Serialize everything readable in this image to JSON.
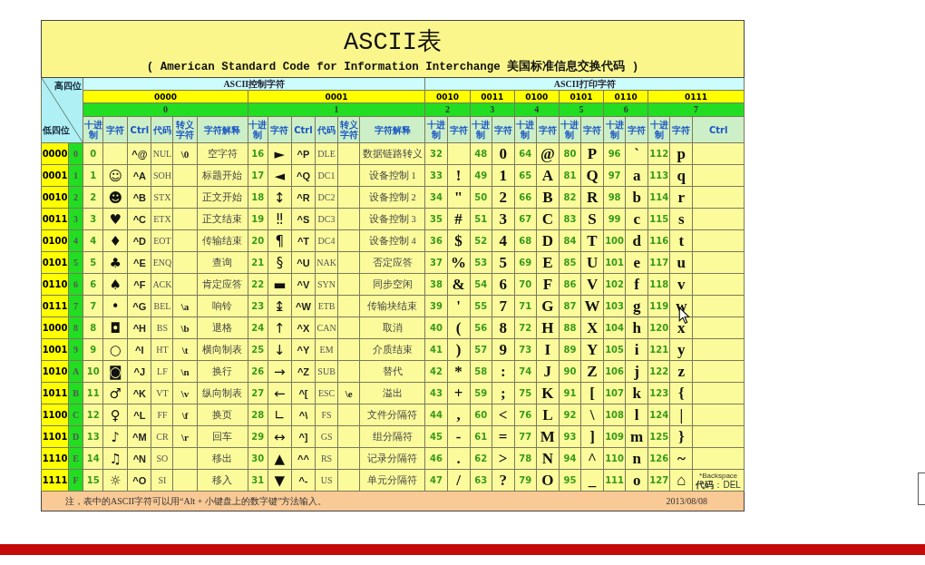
{
  "title": "ASCII表",
  "subtitle": "( American Standard Code for Information Interchange  美国标准信息交换代码 )",
  "corner": {
    "high": "高四位",
    "low": "低四位"
  },
  "sections": [
    {
      "label": "ASCII控制字符",
      "groups": [
        {
          "kind": "control",
          "bits": "0000",
          "hex": "0",
          "headers": [
            "十进制",
            "字符",
            "Ctrl",
            "代码",
            "转义字符",
            "字符解释"
          ]
        },
        {
          "kind": "control",
          "bits": "0001",
          "hex": "1",
          "headers": [
            "十进制",
            "字符",
            "Ctrl",
            "代码",
            "转义字符",
            "字符解释"
          ]
        }
      ]
    },
    {
      "label": "ASCII打印字符",
      "groups": [
        {
          "kind": "printable",
          "bits": "0010",
          "hex": "2",
          "headers": [
            "十进制",
            "字符"
          ]
        },
        {
          "kind": "printable",
          "bits": "0011",
          "hex": "3",
          "headers": [
            "十进制",
            "字符"
          ]
        },
        {
          "kind": "printable",
          "bits": "0100",
          "hex": "4",
          "headers": [
            "十进制",
            "字符"
          ]
        },
        {
          "kind": "printable",
          "bits": "0101",
          "hex": "5",
          "headers": [
            "十进制",
            "字符"
          ]
        },
        {
          "kind": "printable",
          "bits": "0110",
          "hex": "6",
          "headers": [
            "十进制",
            "字符"
          ]
        },
        {
          "kind": "printable_ctrl",
          "bits": "0111",
          "hex": "7",
          "headers": [
            "十进制",
            "字符",
            "Ctrl"
          ]
        }
      ]
    }
  ],
  "rows": [
    {
      "bits": "0000",
      "hex": "0",
      "groups": [
        {
          "dec": "0",
          "ctrl": "^@",
          "code": "NUL",
          "esc": "\\0",
          "desc": "空字符"
        },
        {
          "dec": "16",
          "char": "►",
          "ctrl": "^P",
          "code": "DLE",
          "desc": "数据链路转义"
        },
        {
          "dec": "32"
        },
        {
          "dec": "48",
          "char": "0"
        },
        {
          "dec": "64",
          "char": "@"
        },
        {
          "dec": "80",
          "char": "P"
        },
        {
          "dec": "96",
          "char": "`"
        },
        {
          "dec": "112",
          "char": "p"
        }
      ]
    },
    {
      "bits": "0001",
      "hex": "1",
      "groups": [
        {
          "dec": "1",
          "char": "☺",
          "ctrl": "^A",
          "code": "SOH",
          "desc": "标题开始"
        },
        {
          "dec": "17",
          "char": "◄",
          "ctrl": "^Q",
          "code": "DC1",
          "desc": "设备控制 1"
        },
        {
          "dec": "33",
          "char": "!"
        },
        {
          "dec": "49",
          "char": "1"
        },
        {
          "dec": "65",
          "char": "A"
        },
        {
          "dec": "81",
          "char": "Q"
        },
        {
          "dec": "97",
          "char": "a"
        },
        {
          "dec": "113",
          "char": "q"
        }
      ]
    },
    {
      "bits": "0010",
      "hex": "2",
      "groups": [
        {
          "dec": "2",
          "char": "☻",
          "ctrl": "^B",
          "code": "STX",
          "desc": "正文开始"
        },
        {
          "dec": "18",
          "char": "↕",
          "ctrl": "^R",
          "code": "DC2",
          "desc": "设备控制 2"
        },
        {
          "dec": "34",
          "char": "\""
        },
        {
          "dec": "50",
          "char": "2"
        },
        {
          "dec": "66",
          "char": "B"
        },
        {
          "dec": "82",
          "char": "R"
        },
        {
          "dec": "98",
          "char": "b"
        },
        {
          "dec": "114",
          "char": "r"
        }
      ]
    },
    {
      "bits": "0011",
      "hex": "3",
      "groups": [
        {
          "dec": "3",
          "char": "♥",
          "ctrl": "^C",
          "code": "ETX",
          "desc": "正文结束"
        },
        {
          "dec": "19",
          "char": "‼",
          "ctrl": "^S",
          "code": "DC3",
          "desc": "设备控制 3"
        },
        {
          "dec": "35",
          "char": "#"
        },
        {
          "dec": "51",
          "char": "3"
        },
        {
          "dec": "67",
          "char": "C"
        },
        {
          "dec": "83",
          "char": "S"
        },
        {
          "dec": "99",
          "char": "c"
        },
        {
          "dec": "115",
          "char": "s"
        }
      ]
    },
    {
      "bits": "0100",
      "hex": "4",
      "groups": [
        {
          "dec": "4",
          "char": "♦",
          "ctrl": "^D",
          "code": "EOT",
          "desc": "传输结束"
        },
        {
          "dec": "20",
          "char": "¶",
          "ctrl": "^T",
          "code": "DC4",
          "desc": "设备控制 4"
        },
        {
          "dec": "36",
          "char": "$"
        },
        {
          "dec": "52",
          "char": "4"
        },
        {
          "dec": "68",
          "char": "D"
        },
        {
          "dec": "84",
          "char": "T"
        },
        {
          "dec": "100",
          "char": "d"
        },
        {
          "dec": "116",
          "char": "t"
        }
      ]
    },
    {
      "bits": "0101",
      "hex": "5",
      "groups": [
        {
          "dec": "5",
          "char": "♣",
          "ctrl": "^E",
          "code": "ENQ",
          "desc": "查询"
        },
        {
          "dec": "21",
          "char": "§",
          "ctrl": "^U",
          "code": "NAK",
          "desc": "否定应答"
        },
        {
          "dec": "37",
          "char": "%"
        },
        {
          "dec": "53",
          "char": "5"
        },
        {
          "dec": "69",
          "char": "E"
        },
        {
          "dec": "85",
          "char": "U"
        },
        {
          "dec": "101",
          "char": "e"
        },
        {
          "dec": "117",
          "char": "u"
        }
      ]
    },
    {
      "bits": "0110",
      "hex": "6",
      "groups": [
        {
          "dec": "6",
          "char": "♠",
          "ctrl": "^F",
          "code": "ACK",
          "desc": "肯定应答"
        },
        {
          "dec": "22",
          "char": "▬",
          "ctrl": "^V",
          "code": "SYN",
          "desc": "同步空闲"
        },
        {
          "dec": "38",
          "char": "&"
        },
        {
          "dec": "54",
          "char": "6"
        },
        {
          "dec": "70",
          "char": "F"
        },
        {
          "dec": "86",
          "char": "V"
        },
        {
          "dec": "102",
          "char": "f"
        },
        {
          "dec": "118",
          "char": "v"
        }
      ]
    },
    {
      "bits": "0111",
      "hex": "7",
      "groups": [
        {
          "dec": "7",
          "char": "•",
          "ctrl": "^G",
          "code": "BEL",
          "esc": "\\a",
          "desc": "响铃"
        },
        {
          "dec": "23",
          "char": "↨",
          "ctrl": "^W",
          "code": "ETB",
          "desc": "传输块结束"
        },
        {
          "dec": "39",
          "char": "'"
        },
        {
          "dec": "55",
          "char": "7"
        },
        {
          "dec": "71",
          "char": "G"
        },
        {
          "dec": "87",
          "char": "W"
        },
        {
          "dec": "103",
          "char": "g"
        },
        {
          "dec": "119",
          "char": "w"
        }
      ]
    },
    {
      "bits": "1000",
      "hex": "8",
      "groups": [
        {
          "dec": "8",
          "char": "◘",
          "ctrl": "^H",
          "code": "BS",
          "esc": "\\b",
          "desc": "退格"
        },
        {
          "dec": "24",
          "char": "↑",
          "ctrl": "^X",
          "code": "CAN",
          "desc": "取消"
        },
        {
          "dec": "40",
          "char": "("
        },
        {
          "dec": "56",
          "char": "8"
        },
        {
          "dec": "72",
          "char": "H"
        },
        {
          "dec": "88",
          "char": "X"
        },
        {
          "dec": "104",
          "char": "h"
        },
        {
          "dec": "120",
          "char": "x"
        }
      ]
    },
    {
      "bits": "1001",
      "hex": "9",
      "groups": [
        {
          "dec": "9",
          "char": "○",
          "ctrl": "^I",
          "code": "HT",
          "esc": "\\t",
          "desc": "横向制表"
        },
        {
          "dec": "25",
          "char": "↓",
          "ctrl": "^Y",
          "code": "EM",
          "desc": "介质结束"
        },
        {
          "dec": "41",
          "char": ")"
        },
        {
          "dec": "57",
          "char": "9"
        },
        {
          "dec": "73",
          "char": "I"
        },
        {
          "dec": "89",
          "char": "Y"
        },
        {
          "dec": "105",
          "char": "i"
        },
        {
          "dec": "121",
          "char": "y"
        }
      ]
    },
    {
      "bits": "1010",
      "hex": "A",
      "groups": [
        {
          "dec": "10",
          "char": "◙",
          "ctrl": "^J",
          "code": "LF",
          "esc": "\\n",
          "desc": "换行"
        },
        {
          "dec": "26",
          "char": "→",
          "ctrl": "^Z",
          "code": "SUB",
          "desc": "替代"
        },
        {
          "dec": "42",
          "char": "*"
        },
        {
          "dec": "58",
          "char": ":"
        },
        {
          "dec": "74",
          "char": "J"
        },
        {
          "dec": "90",
          "char": "Z"
        },
        {
          "dec": "106",
          "char": "j"
        },
        {
          "dec": "122",
          "char": "z"
        }
      ]
    },
    {
      "bits": "1011",
      "hex": "B",
      "groups": [
        {
          "dec": "11",
          "char": "♂",
          "ctrl": "^K",
          "code": "VT",
          "esc": "\\v",
          "desc": "纵向制表"
        },
        {
          "dec": "27",
          "char": "←",
          "ctrl": "^[",
          "code": "ESC",
          "esc": "\\e",
          "desc": "溢出"
        },
        {
          "dec": "43",
          "char": "+"
        },
        {
          "dec": "59",
          "char": ";"
        },
        {
          "dec": "75",
          "char": "K"
        },
        {
          "dec": "91",
          "char": "["
        },
        {
          "dec": "107",
          "char": "k"
        },
        {
          "dec": "123",
          "char": "{"
        }
      ]
    },
    {
      "bits": "1100",
      "hex": "C",
      "groups": [
        {
          "dec": "12",
          "char": "♀",
          "ctrl": "^L",
          "code": "FF",
          "esc": "\\f",
          "desc": "换页"
        },
        {
          "dec": "28",
          "char": "∟",
          "ctrl": "^\\",
          "code": "FS",
          "desc": "文件分隔符"
        },
        {
          "dec": "44",
          "char": ","
        },
        {
          "dec": "60",
          "char": "<"
        },
        {
          "dec": "76",
          "char": "L"
        },
        {
          "dec": "92",
          "char": "\\"
        },
        {
          "dec": "108",
          "char": "l"
        },
        {
          "dec": "124",
          "char": "|"
        }
      ]
    },
    {
      "bits": "1101",
      "hex": "D",
      "groups": [
        {
          "dec": "13",
          "char": "♪",
          "ctrl": "^M",
          "code": "CR",
          "esc": "\\r",
          "desc": "回车"
        },
        {
          "dec": "29",
          "char": "↔",
          "ctrl": "^]",
          "code": "GS",
          "desc": "组分隔符"
        },
        {
          "dec": "45",
          "char": "-"
        },
        {
          "dec": "61",
          "char": "="
        },
        {
          "dec": "77",
          "char": "M"
        },
        {
          "dec": "93",
          "char": "]"
        },
        {
          "dec": "109",
          "char": "m"
        },
        {
          "dec": "125",
          "char": "}"
        }
      ]
    },
    {
      "bits": "1110",
      "hex": "E",
      "groups": [
        {
          "dec": "14",
          "char": "♫",
          "ctrl": "^N",
          "code": "SO",
          "desc": "移出"
        },
        {
          "dec": "30",
          "char": "▲",
          "ctrl": "^^",
          "code": "RS",
          "desc": "记录分隔符"
        },
        {
          "dec": "46",
          "char": "."
        },
        {
          "dec": "62",
          "char": ">"
        },
        {
          "dec": "78",
          "char": "N"
        },
        {
          "dec": "94",
          "char": "^"
        },
        {
          "dec": "110",
          "char": "n"
        },
        {
          "dec": "126",
          "char": "~"
        }
      ]
    },
    {
      "bits": "1111",
      "hex": "F",
      "groups": [
        {
          "dec": "15",
          "char": "☼",
          "ctrl": "^O",
          "code": "SI",
          "desc": "移入"
        },
        {
          "dec": "31",
          "char": "▼",
          "ctrl": "^-",
          "code": "US",
          "desc": "单元分隔符"
        },
        {
          "dec": "47",
          "char": "/"
        },
        {
          "dec": "63",
          "char": "?"
        },
        {
          "dec": "79",
          "char": "O"
        },
        {
          "dec": "95",
          "char": "_"
        },
        {
          "dec": "111",
          "char": "o"
        },
        {
          "dec": "127",
          "char": "⌂",
          "ctrl": "*Backspace",
          "ctrl_note": "**代码**：DEL"
        }
      ]
    }
  ],
  "footer": {
    "note": "注，表中的ASCII字符可以用“Alt + 小键盘上的数字键”方法输入。",
    "date": "2013/08/08"
  }
}
